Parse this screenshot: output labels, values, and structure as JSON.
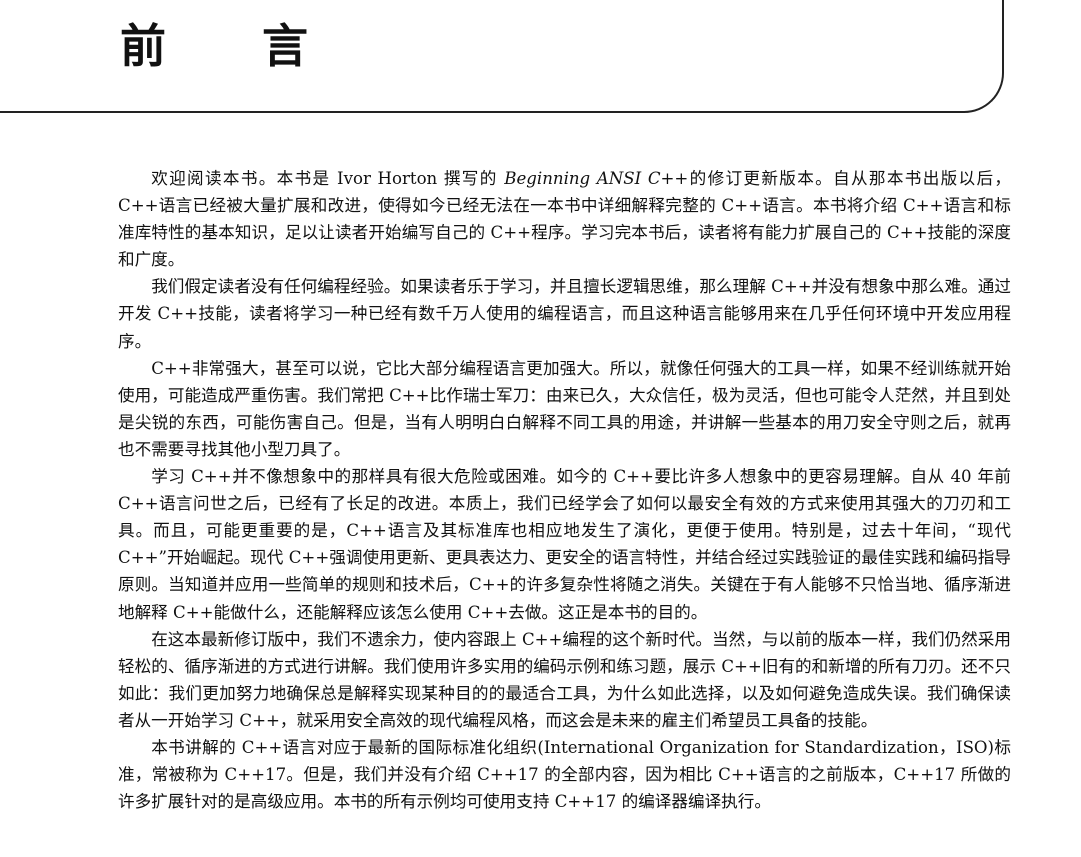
{
  "header": {
    "title_char_1": "前",
    "title_char_2": "言"
  },
  "paragraphs": [
    {
      "before_italic": "欢迎阅读本书。本书是 Ivor Horton 撰写的 ",
      "italic": "Beginning ANSI C++",
      "after_italic": "的修订更新版本。自从那本书出版以后，C++语言已经被大量扩展和改进，使得如今已经无法在一本书中详细解释完整的 C++语言。本书将介绍 C++语言和标准库特性的基本知识，足以让读者开始编写自己的 C++程序。学习完本书后，读者将有能力扩展自己的 C++技能的深度和广度。"
    },
    {
      "text": "我们假定读者没有任何编程经验。如果读者乐于学习，并且擅长逻辑思维，那么理解 C++并没有想象中那么难。通过开发 C++技能，读者将学习一种已经有数千万人使用的编程语言，而且这种语言能够用来在几乎任何环境中开发应用程序。"
    },
    {
      "text": "C++非常强大，甚至可以说，它比大部分编程语言更加强大。所以，就像任何强大的工具一样，如果不经训练就开始使用，可能造成严重伤害。我们常把 C++比作瑞士军刀：由来已久，大众信任，极为灵活，但也可能令人茫然，并且到处是尖锐的东西，可能伤害自己。但是，当有人明明白白解释不同工具的用途，并讲解一些基本的用刀安全守则之后，就再也不需要寻找其他小型刀具了。"
    },
    {
      "text": "学习 C++并不像想象中的那样具有很大危险或困难。如今的 C++要比许多人想象中的更容易理解。自从 40 年前 C++语言问世之后，已经有了长足的改进。本质上，我们已经学会了如何以最安全有效的方式来使用其强大的刀刃和工具。而且，可能更重要的是，C++语言及其标准库也相应地发生了演化，更便于使用。特别是，过去十年间，“现代 C++”开始崛起。现代 C++强调使用更新、更具表达力、更安全的语言特性，并结合经过实践验证的最佳实践和编码指导原则。当知道并应用一些简单的规则和技术后，C++的许多复杂性将随之消失。关键在于有人能够不只恰当地、循序渐进地解释 C++能做什么，还能解释应该怎么使用 C++去做。这正是本书的目的。"
    },
    {
      "text": "在这本最新修订版中，我们不遗余力，使内容跟上 C++编程的这个新时代。当然，与以前的版本一样，我们仍然采用轻松的、循序渐进的方式进行讲解。我们使用许多实用的编码示例和练习题，展示 C++旧有的和新增的所有刀刃。还不只如此：我们更加努力地确保总是解释实现某种目的的最适合工具，为什么如此选择，以及如何避免造成失误。我们确保读者从一开始学习 C++，就采用安全高效的现代编程风格，而这会是未来的雇主们希望员工具备的技能。"
    },
    {
      "text": "本书讲解的 C++语言对应于最新的国际标准化组织(International Organization for Standardization，ISO)标准，常被称为 C++17。但是，我们并没有介绍 C++17 的全部内容，因为相比 C++语言的之前版本，C++17 所做的许多扩展针对的是高级应用。本书的所有示例均可使用支持 C++17 的编译器编译执行。"
    }
  ]
}
